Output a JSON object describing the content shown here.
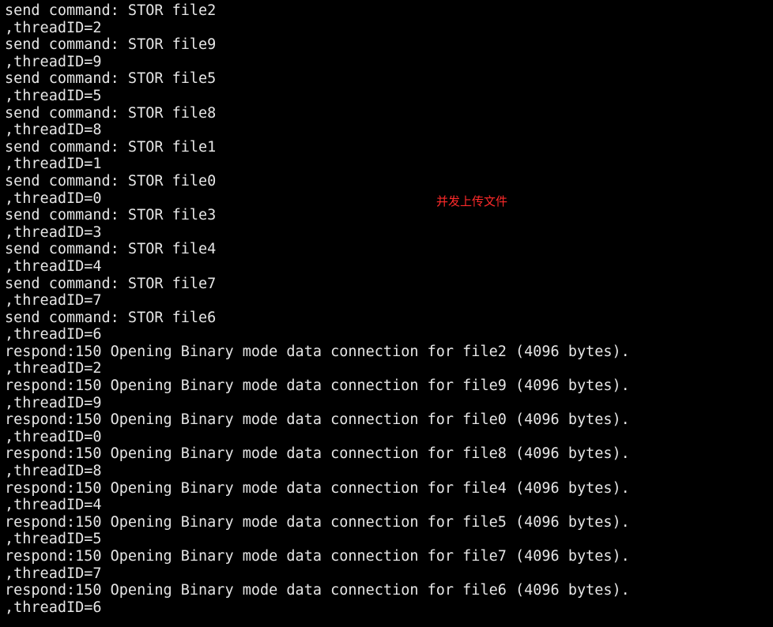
{
  "terminal": {
    "lines": [
      "send command: STOR file2",
      ",threadID=2",
      "send command: STOR file9",
      ",threadID=9",
      "send command: STOR file5",
      ",threadID=5",
      "send command: STOR file8",
      ",threadID=8",
      "send command: STOR file1",
      ",threadID=1",
      "send command: STOR file0",
      ",threadID=0",
      "send command: STOR file3",
      ",threadID=3",
      "send command: STOR file4",
      ",threadID=4",
      "send command: STOR file7",
      ",threadID=7",
      "send command: STOR file6",
      ",threadID=6",
      "respond:150 Opening Binary mode data connection for file2 (4096 bytes).",
      ",threadID=2",
      "respond:150 Opening Binary mode data connection for file9 (4096 bytes).",
      ",threadID=9",
      "respond:150 Opening Binary mode data connection for file0 (4096 bytes).",
      ",threadID=0",
      "respond:150 Opening Binary mode data connection for file8 (4096 bytes).",
      ",threadID=8",
      "respond:150 Opening Binary mode data connection for file4 (4096 bytes).",
      ",threadID=4",
      "respond:150 Opening Binary mode data connection for file5 (4096 bytes).",
      ",threadID=5",
      "respond:150 Opening Binary mode data connection for file7 (4096 bytes).",
      ",threadID=7",
      "respond:150 Opening Binary mode data connection for file6 (4096 bytes).",
      ",threadID=6"
    ]
  },
  "annotation": {
    "text": "并发上传文件"
  },
  "colors": {
    "background": "#000000",
    "text": "#e6e6e6",
    "annotation": "#ff2a2a"
  }
}
